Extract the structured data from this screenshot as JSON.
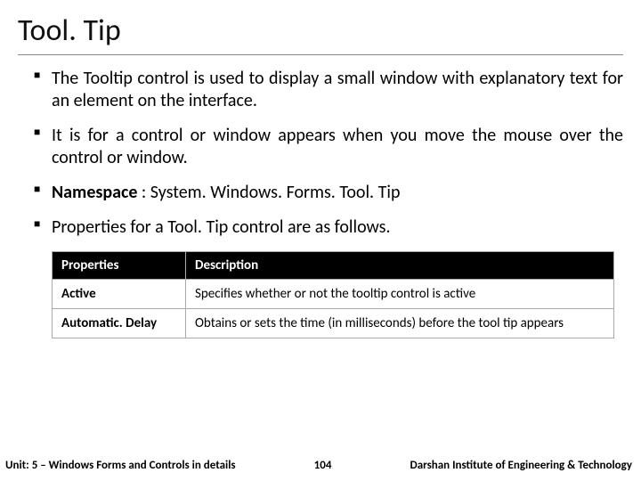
{
  "title": "Tool. Tip",
  "bullets": {
    "b1": "The Tooltip control is used to display a small window with explanatory text for an element on the interface.",
    "b2": "It is for a control or window appears when you move the mouse over the control or window.",
    "b3_label": "Namespace",
    "b3_value": " : System. Windows. Forms. Tool. Tip",
    "b4": "Properties for a Tool. Tip control are as follows."
  },
  "table": {
    "h1": "Properties",
    "h2": "Description",
    "r1c1": "Active",
    "r1c2": "Specifies whether or not the tooltip control is active",
    "r2c1": "Automatic. Delay",
    "r2c2": "Obtains or sets the time (in milliseconds) before the tool tip appears"
  },
  "footer": {
    "left": "Unit: 5 – Windows Forms and Controls in details",
    "page": "104",
    "right": "Darshan Institute of Engineering & Technology"
  }
}
